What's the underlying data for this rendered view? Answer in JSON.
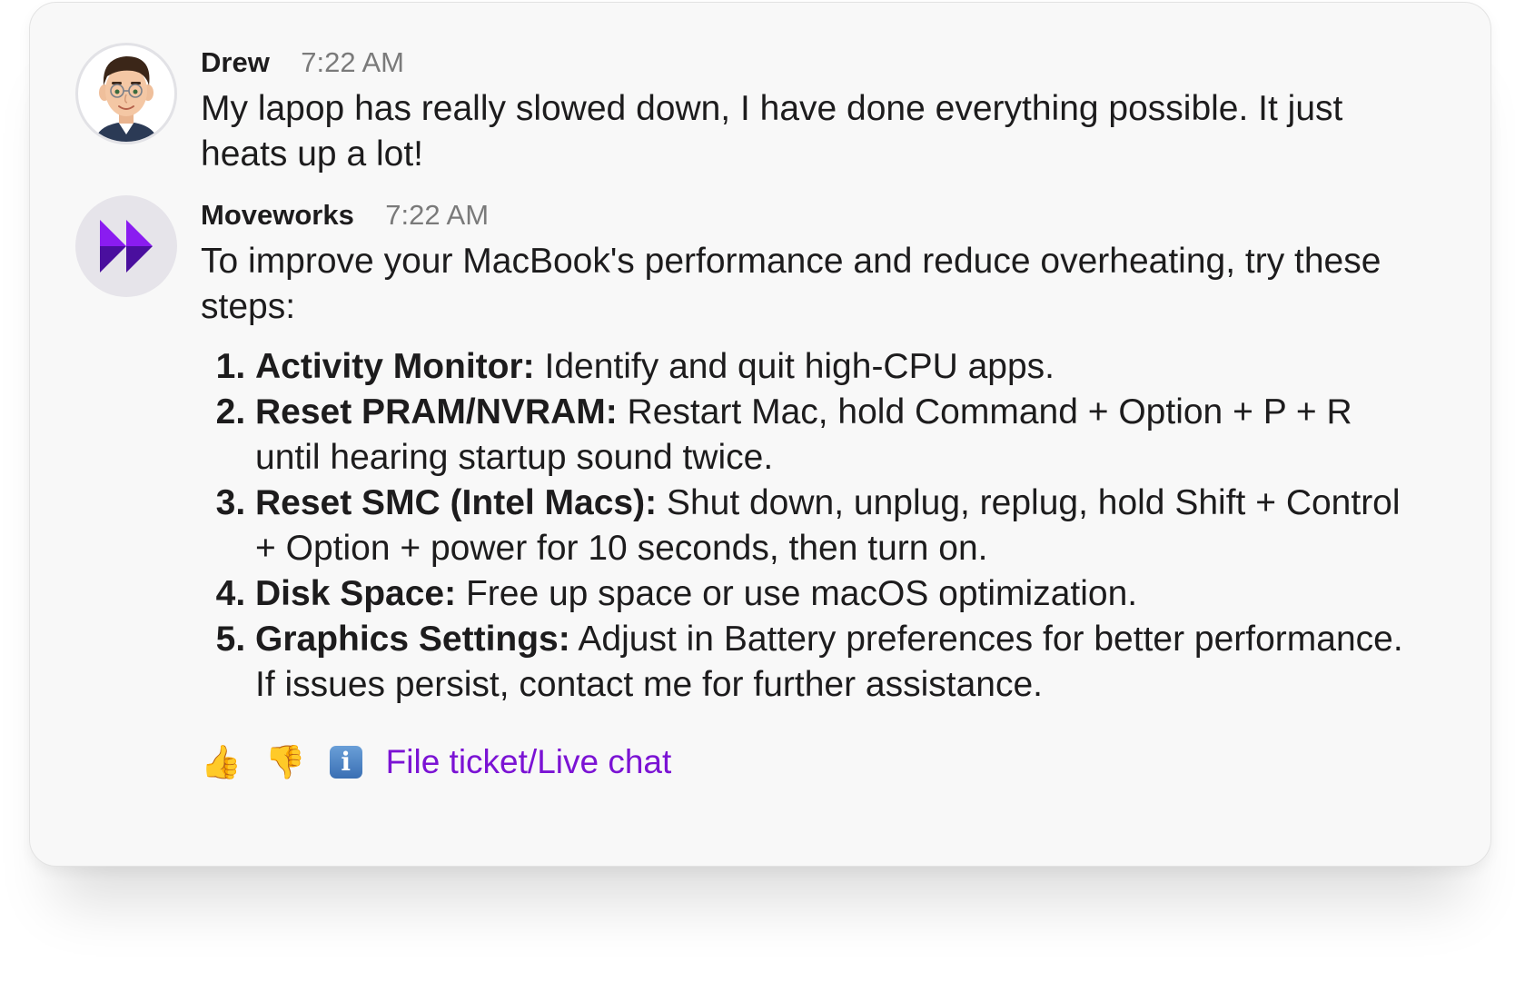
{
  "messages": [
    {
      "sender": "Drew",
      "time": "7:22 AM",
      "avatar": "memoji-avatar",
      "text": "My lapop has really slowed down, I have done everything possible. It just heats up a lot!"
    },
    {
      "sender": "Moveworks",
      "time": "7:22 AM",
      "avatar": "moveworks-logo",
      "intro": "To improve your MacBook's performance and reduce overheating, try these steps:",
      "steps": [
        {
          "title": "Activity Monitor:",
          "text": " Identify and quit high-CPU apps."
        },
        {
          "title": "Reset PRAM/NVRAM:",
          "text": " Restart Mac, hold Command + Option + P + R until hearing startup sound twice."
        },
        {
          "title": "Reset SMC (Intel Macs):",
          "text": " Shut down, unplug, replug, hold Shift + Control + Option + power for 10 seconds, then turn on."
        },
        {
          "title": "Disk Space:",
          "text": " Free up space or use macOS optimization."
        },
        {
          "title": "Graphics Settings:",
          "text": " Adjust in Battery preferences for better performance. If issues persist, contact me for further assistance."
        }
      ],
      "actions": {
        "thumbs_up": "👍",
        "thumbs_down": "👎",
        "info": "i",
        "link_label": "File ticket/Live chat"
      }
    }
  ],
  "colors": {
    "link": "#7b13d4",
    "brand_purple_light": "#8a1cf0",
    "brand_purple_dark": "#4a0f9e",
    "card_background": "#f8f8f8"
  }
}
